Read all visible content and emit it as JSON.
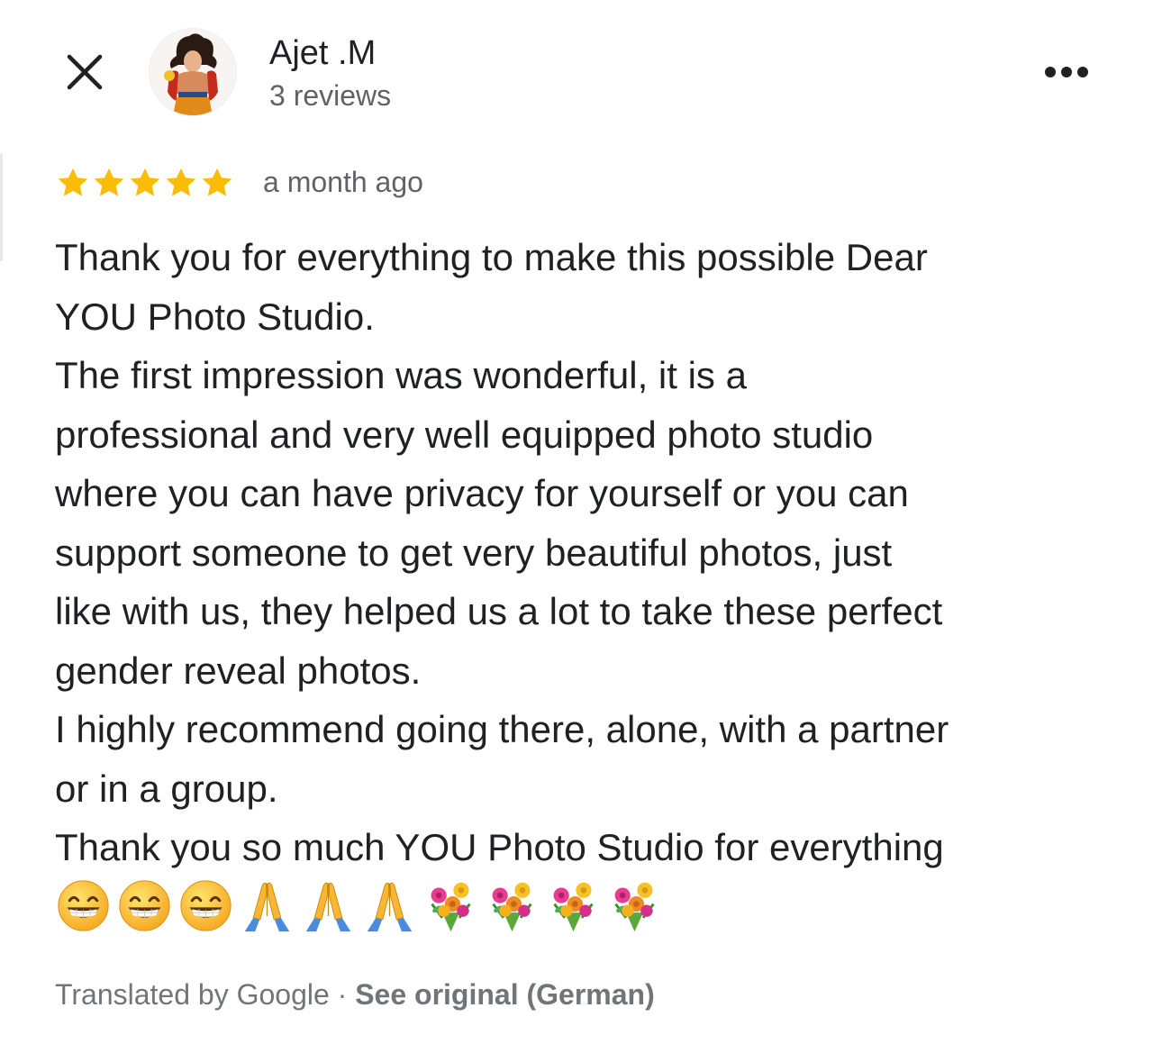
{
  "header": {
    "close_icon": "close-icon",
    "avatar_icon": "avatar",
    "author_name": "Ajet .M",
    "review_count": "3 reviews",
    "more_icon": "more-options-icon"
  },
  "review": {
    "rating": 5,
    "max_rating": 5,
    "star_color": "#fbbc04",
    "time_ago": "a month ago",
    "text_lines": [
      "Thank you for everything to make this possible Dear",
      "YOU Photo Studio.",
      "The first impression was wonderful, it is a",
      "professional and very well equipped photo studio",
      "where you can have privacy for yourself or you can",
      "support someone to get very beautiful photos, just",
      "like with us, they helped us a lot to take these perfect",
      "gender reveal photos.",
      "I highly recommend going there, alone, with a partner",
      "or in a group.",
      "Thank you so much YOU Photo Studio for everything"
    ],
    "emojis": [
      "grinning-face",
      "grinning-face",
      "grinning-face",
      "folded-hands",
      "folded-hands",
      "folded-hands",
      "bouquet",
      "bouquet",
      "bouquet",
      "bouquet"
    ]
  },
  "footer": {
    "translated_by": "Translated by Google",
    "separator": "·",
    "see_original": "See original (German)"
  }
}
